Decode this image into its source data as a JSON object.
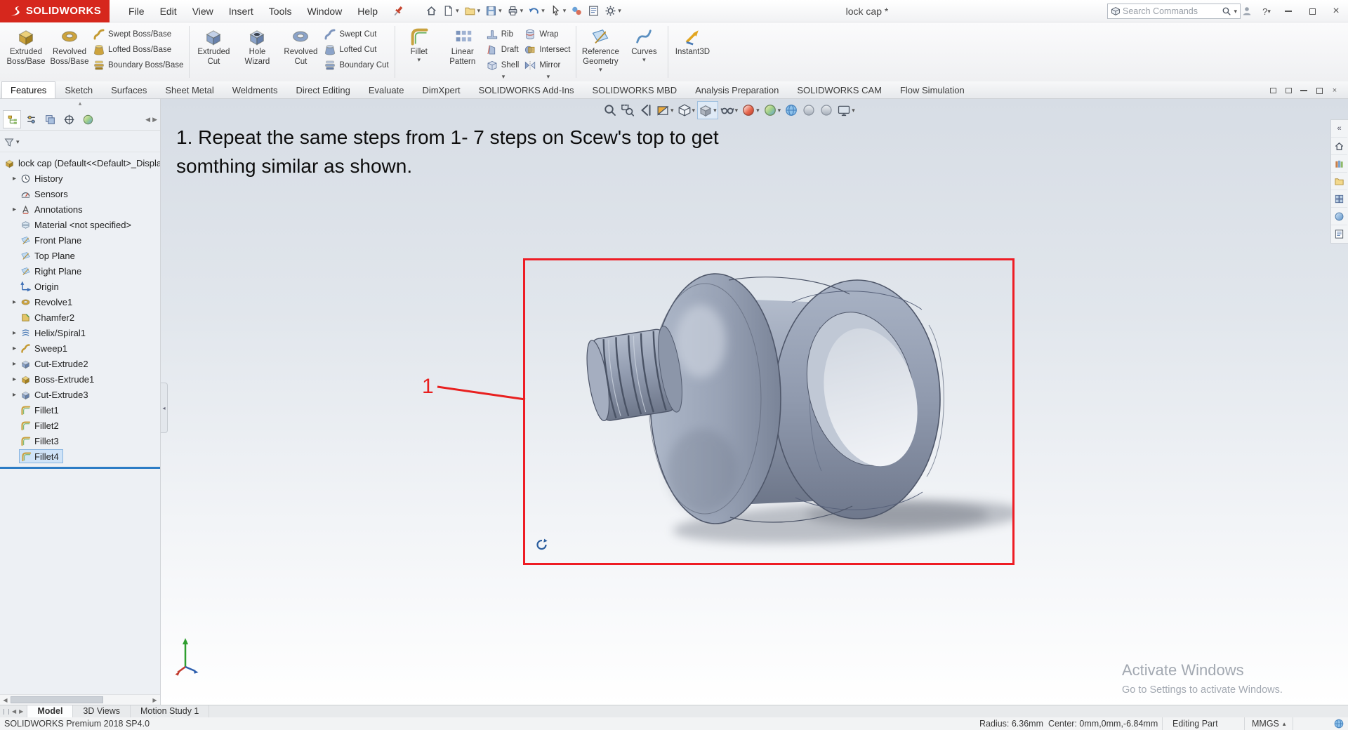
{
  "icons": {
    "caret_down": "▾",
    "expand_arrow": "▸",
    "left_arrow": "◀",
    "right_arrow": "▶",
    "collapse_up": "▴",
    "collapse_left": "◂",
    "double_chevron_left": "«",
    "close": "×",
    "help": "?",
    "units_caret": "▴"
  },
  "titlebar": {
    "logo_text": "SOLIDWORKS",
    "menus": [
      "File",
      "Edit",
      "View",
      "Insert",
      "Tools",
      "Window",
      "Help"
    ],
    "document_title": "lock cap *",
    "search_placeholder": "Search Commands"
  },
  "ribbon": {
    "group1": {
      "big": [
        {
          "l1": "Extruded",
          "l2": "Boss/Base"
        },
        {
          "l1": "Revolved",
          "l2": "Boss/Base"
        }
      ],
      "small": [
        "Swept Boss/Base",
        "Lofted Boss/Base",
        "Boundary Boss/Base"
      ]
    },
    "group2": {
      "big": [
        {
          "l1": "Extruded",
          "l2": "Cut"
        },
        {
          "l1": "Hole",
          "l2": "Wizard"
        },
        {
          "l1": "Revolved",
          "l2": "Cut"
        }
      ],
      "small": [
        "Swept Cut",
        "Lofted Cut",
        "Boundary Cut"
      ]
    },
    "group3": {
      "big": [
        {
          "l1": "Fillet",
          "l2": ""
        },
        {
          "l1": "Linear",
          "l2": "Pattern"
        }
      ],
      "col1": [
        "Rib",
        "Draft",
        "Shell"
      ],
      "col2": [
        "Wrap",
        "Intersect",
        "Mirror"
      ]
    },
    "group4": {
      "big": [
        {
          "l1": "Reference",
          "l2": "Geometry"
        },
        {
          "l1": "Curves",
          "l2": ""
        }
      ]
    },
    "group5": {
      "big": [
        {
          "l1": "Instant3D",
          "l2": ""
        }
      ]
    }
  },
  "command_tabs": [
    "Features",
    "Sketch",
    "Surfaces",
    "Sheet Metal",
    "Weldments",
    "Direct Editing",
    "Evaluate",
    "DimXpert",
    "SOLIDWORKS Add-Ins",
    "SOLIDWORKS MBD",
    "Analysis Preparation",
    "SOLIDWORKS CAM",
    "Flow Simulation"
  ],
  "feature_tree": {
    "root_label": "lock cap (Default<<Default>_Display",
    "items": [
      {
        "label": "History",
        "icon": "history-icon",
        "expandable": true
      },
      {
        "label": "Sensors",
        "icon": "sensors-icon",
        "expandable": false
      },
      {
        "label": "Annotations",
        "icon": "annotations-icon",
        "expandable": true
      },
      {
        "label": "Material <not specified>",
        "icon": "material-icon",
        "expandable": false
      },
      {
        "label": "Front Plane",
        "icon": "plane-icon",
        "expandable": false
      },
      {
        "label": "Top Plane",
        "icon": "plane-icon",
        "expandable": false
      },
      {
        "label": "Right Plane",
        "icon": "plane-icon",
        "expandable": false
      },
      {
        "label": "Origin",
        "icon": "origin-icon",
        "expandable": false
      },
      {
        "label": "Revolve1",
        "icon": "revolve-icon",
        "expandable": true
      },
      {
        "label": "Chamfer2",
        "icon": "chamfer-icon",
        "expandable": false
      },
      {
        "label": "Helix/Spiral1",
        "icon": "helix-icon",
        "expandable": true
      },
      {
        "label": "Sweep1",
        "icon": "sweep-icon",
        "expandable": true
      },
      {
        "label": "Cut-Extrude2",
        "icon": "cut-extrude-icon",
        "expandable": true
      },
      {
        "label": "Boss-Extrude1",
        "icon": "boss-extrude-icon",
        "expandable": true
      },
      {
        "label": "Cut-Extrude3",
        "icon": "cut-extrude-icon",
        "expandable": true
      },
      {
        "label": "Fillet1",
        "icon": "fillet-icon",
        "expandable": false
      },
      {
        "label": "Fillet2",
        "icon": "fillet-icon",
        "expandable": false
      },
      {
        "label": "Fillet3",
        "icon": "fillet-icon",
        "expandable": false
      },
      {
        "label": "Fillet4",
        "icon": "fillet-icon",
        "expandable": false,
        "selected": true
      }
    ]
  },
  "viewport": {
    "instruction_line1": "1. Repeat the same steps from 1- 7 steps on Scew's top to get",
    "instruction_line2": "somthing similar as shown.",
    "callout_label": "1",
    "watermark_line1": "Activate Windows",
    "watermark_line2": "Go to Settings to activate Windows."
  },
  "hud_buttons": [
    "zoom-to-fit",
    "zoom-to-area",
    "previous-view",
    "section-view",
    "view-orientation",
    "display-style",
    "hide-show-items",
    "edit-appearance",
    "apply-scene",
    "view-settings",
    "shadows-in-shaded-mode",
    "perspective",
    "camera-views"
  ],
  "panel_manager_tabs": [
    "featuremanager-design-tree",
    "propertymanager",
    "configurationmanager",
    "dimxpertmanager",
    "displaymanager"
  ],
  "task_pane_tabs": [
    "collapse-task-pane",
    "solidworks-resources",
    "design-library",
    "file-explorer",
    "view-palette",
    "appearances-scenes",
    "custom-properties"
  ],
  "bottom_tabs": [
    "Model",
    "3D Views",
    "Motion Study 1"
  ],
  "statusbar": {
    "app_version": "SOLIDWORKS Premium 2018 SP4.0",
    "measurement": "Radius: 6.36mm  Center: 0mm,0mm,-6.84mm",
    "mode": "Editing Part",
    "units": "MMGS"
  }
}
